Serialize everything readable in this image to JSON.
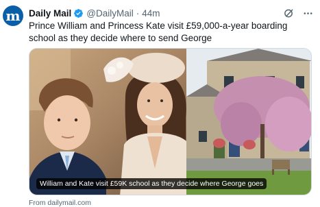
{
  "account": {
    "avatar_letter": "m",
    "display_name": "Daily Mail",
    "handle": "@DailyMail",
    "separator": "·",
    "time": "44m",
    "verified_color": "#1d9bf0"
  },
  "tweet": {
    "text": "Prince William and Princess Kate visit £59,000-a-year boarding school as they decide where to send George"
  },
  "card": {
    "caption": "William and Kate visit £59K school as they decide where George goes",
    "source": "From dailymail.com"
  },
  "icons": {
    "grok": "grok-icon",
    "more": "more-icon",
    "verified": "verified-badge-icon"
  }
}
